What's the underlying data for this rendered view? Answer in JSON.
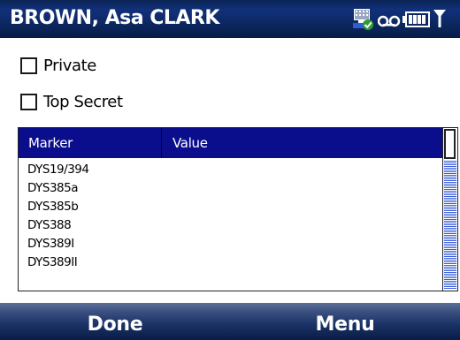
{
  "title_bar": {
    "title": "BROWN, Asa CLARK",
    "status_icons": [
      "connectivity-icon",
      "voicemail-icon",
      "battery-icon",
      "signal-icon"
    ]
  },
  "checkboxes": [
    {
      "label": "Private",
      "checked": false
    },
    {
      "label": "Top Secret",
      "checked": false
    }
  ],
  "list": {
    "columns": [
      "Marker",
      "Value"
    ],
    "rows": [
      {
        "marker": "DYS19/394",
        "value": ""
      },
      {
        "marker": "DYS385a",
        "value": ""
      },
      {
        "marker": "DYS385b",
        "value": ""
      },
      {
        "marker": "DYS388",
        "value": ""
      },
      {
        "marker": "DYS389I",
        "value": ""
      },
      {
        "marker": "DYS389II",
        "value": ""
      }
    ]
  },
  "softkeys": {
    "left": "Done",
    "right": "Menu"
  },
  "colors": {
    "title_bar": "#0d2a66",
    "list_header": "#0b0e8c",
    "scroll_track": "#3a5ed9"
  }
}
